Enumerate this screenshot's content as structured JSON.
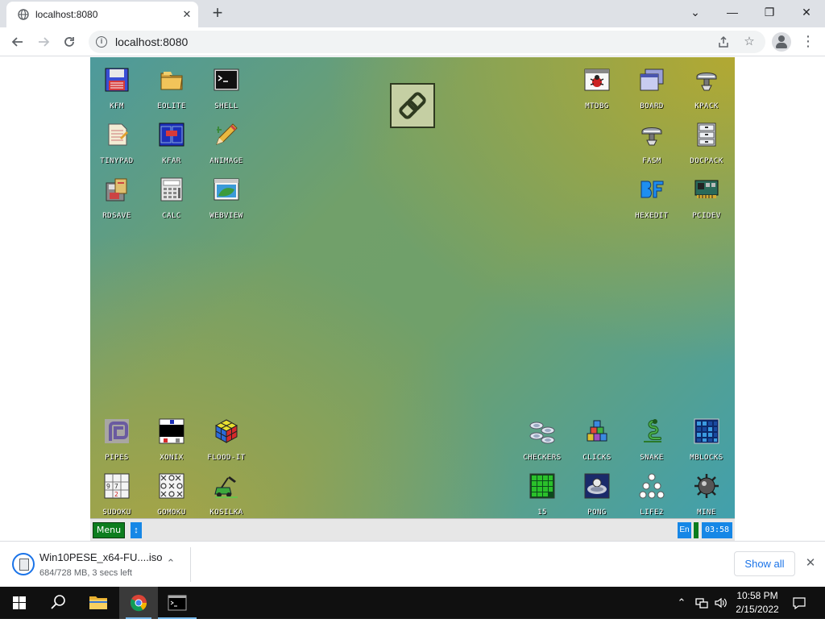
{
  "browser": {
    "tab_title": "localhost:8080",
    "tab_close": "✕",
    "new_tab": "+",
    "url": "localhost:8080",
    "window_controls": {
      "dropdown": "⌄",
      "minimize": "—",
      "restore": "❐",
      "close": "✕"
    }
  },
  "kolibri": {
    "icons_top_left": [
      {
        "label": "KFM",
        "icon": "floppy-icon"
      },
      {
        "label": "EOLITE",
        "icon": "folder-icon"
      },
      {
        "label": "SHELL",
        "icon": "terminal-icon"
      },
      {
        "label": "TINYPAD",
        "icon": "notepad-icon"
      },
      {
        "label": "KFAR",
        "icon": "blue-panels-icon"
      },
      {
        "label": "ANIMAGE",
        "icon": "pencil-icon"
      },
      {
        "label": "RDSAVE",
        "icon": "disk-save-icon"
      },
      {
        "label": "CALC",
        "icon": "calculator-icon"
      },
      {
        "label": "WEBVIEW",
        "icon": "browser-window-icon"
      }
    ],
    "icons_top_right": [
      {
        "label": "MTDBG",
        "icon": "debugger-icon"
      },
      {
        "label": "BOARD",
        "icon": "windows-stack-icon"
      },
      {
        "label": "KPACK",
        "icon": "press-icon"
      },
      {
        "label": "FASM",
        "icon": "press-icon"
      },
      {
        "label": "DOCPACK",
        "icon": "cabinet-icon"
      },
      {
        "label": "HEXEDIT",
        "icon": "bf-icon"
      },
      {
        "label": "PCIDEV",
        "icon": "pci-card-icon"
      }
    ],
    "icons_bottom_left": [
      {
        "label": "PIPES",
        "icon": "pipes-icon"
      },
      {
        "label": "XONIX",
        "icon": "xonix-icon"
      },
      {
        "label": "FLOOD-IT",
        "icon": "cube-icon"
      },
      {
        "label": "SUDOKU",
        "icon": "sudoku-icon"
      },
      {
        "label": "GOMOKU",
        "icon": "gomoku-icon"
      },
      {
        "label": "KOSILKA",
        "icon": "lawnmower-icon"
      }
    ],
    "icons_bottom_right": [
      {
        "label": "CHECKERS",
        "icon": "checkers-icon"
      },
      {
        "label": "CLICKS",
        "icon": "blocks-icon"
      },
      {
        "label": "SNAKE",
        "icon": "snake-icon"
      },
      {
        "label": "MBLOCKS",
        "icon": "grid-icon"
      },
      {
        "label": "15",
        "icon": "fifteen-icon"
      },
      {
        "label": "PONG",
        "icon": "pong-icon"
      },
      {
        "label": "LIFE2",
        "icon": "dots-icon"
      },
      {
        "label": "MINE",
        "icon": "mine-icon"
      }
    ],
    "sudoku_digits": [
      "9",
      "7",
      "2"
    ],
    "taskbar": {
      "menu": "Menu",
      "arrows": "↕",
      "lang": "En",
      "clock": "03:58"
    }
  },
  "downloads": {
    "file_name": "Win10PESE_x64-FU....iso",
    "status": "684/728 MB, 3 secs left",
    "show_all": "Show all",
    "chevron": "⌃",
    "close": "✕"
  },
  "windows_taskbar": {
    "time": "10:58 PM",
    "date": "2/15/2022"
  },
  "colors": {
    "kolibri_menu": "#0c7d1e",
    "kolibri_accent": "#1687e6",
    "chrome_link": "#1a73e8",
    "win_taskbar": "#101010"
  }
}
